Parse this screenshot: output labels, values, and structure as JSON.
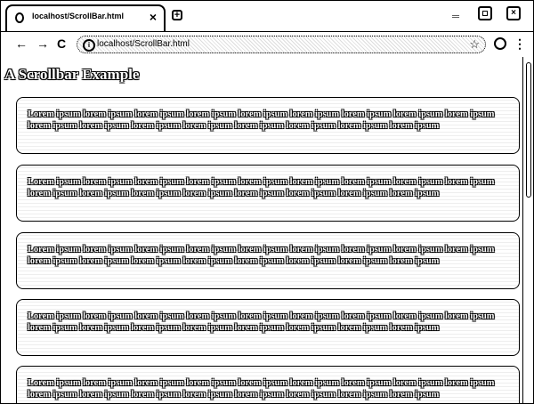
{
  "browser": {
    "tab_title": "localhost/ScrollBar.html",
    "url": "localhost/ScrollBar.html",
    "close_tab_glyph": "×",
    "new_tab_glyph": "+",
    "back_glyph": "←",
    "forward_glyph": "→",
    "reload_glyph": "C",
    "star_glyph": "☆",
    "info_glyph": "i",
    "menu_glyph": "⋮",
    "minimize_glyph": "‗",
    "close_window_glyph": "×"
  },
  "page": {
    "title": "A Scrollbar Example",
    "paragraphs": [
      "Lorem ipsum lorem ipsum lorem ipsum lorem ipsum lorem ipsum lorem ipsum lorem ipsum lorem ipsum lorem ipsum lorem ipsum lorem ipsum lorem ipsum lorem ipsum lorem ipsum lorem ipsum lorem ipsum lorem ipsum",
      "Lorem ipsum lorem ipsum lorem ipsum lorem ipsum lorem ipsum lorem ipsum lorem ipsum lorem ipsum lorem ipsum lorem ipsum lorem ipsum lorem ipsum lorem ipsum lorem ipsum lorem ipsum lorem ipsum lorem ipsum",
      "Lorem ipsum lorem ipsum lorem ipsum lorem ipsum lorem ipsum lorem ipsum lorem ipsum lorem ipsum lorem ipsum lorem ipsum lorem ipsum lorem ipsum lorem ipsum lorem ipsum lorem ipsum lorem ipsum lorem ipsum",
      "Lorem ipsum lorem ipsum lorem ipsum lorem ipsum lorem ipsum lorem ipsum lorem ipsum lorem ipsum lorem ipsum lorem ipsum lorem ipsum lorem ipsum lorem ipsum lorem ipsum lorem ipsum lorem ipsum lorem ipsum",
      "Lorem ipsum lorem ipsum lorem ipsum lorem ipsum lorem ipsum lorem ipsum lorem ipsum lorem ipsum lorem ipsum lorem ipsum lorem ipsum lorem ipsum lorem ipsum lorem ipsum lorem ipsum lorem ipsum lorem ipsum"
    ]
  }
}
